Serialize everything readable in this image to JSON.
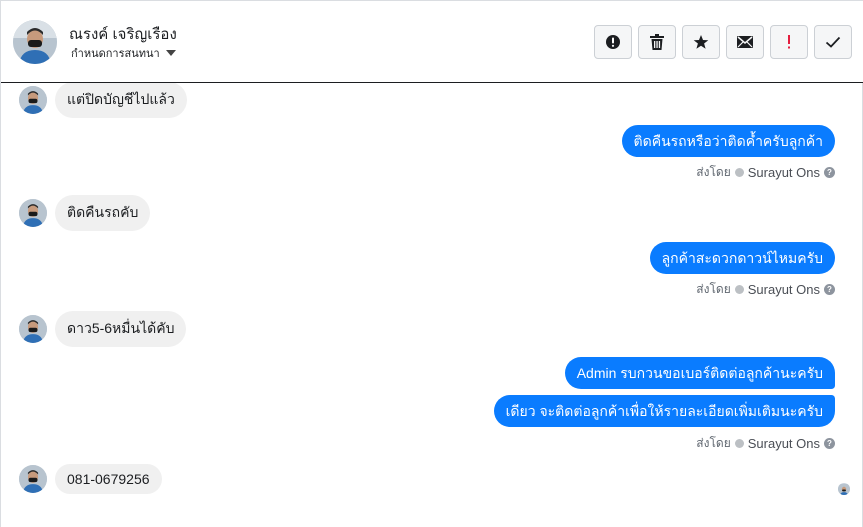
{
  "header": {
    "contact_name": "ณรงค์ เจริญเรือง",
    "subtitle": "กำหนดการสนทนา",
    "actions": [
      {
        "name": "report-spam-button",
        "icon": "exclamation-circle-icon"
      },
      {
        "name": "delete-button",
        "icon": "trash-icon"
      },
      {
        "name": "star-button",
        "icon": "star-icon"
      },
      {
        "name": "mark-unread-button",
        "icon": "envelope-icon"
      },
      {
        "name": "follow-up-button",
        "icon": "exclamation-icon",
        "color": "#e41e3f"
      },
      {
        "name": "mark-done-button",
        "icon": "check-icon"
      }
    ]
  },
  "messages": [
    {
      "direction": "in",
      "text": "แต่ปิดบัญชีไปแล้ว"
    },
    {
      "direction": "out",
      "text": "ติดคืนรถหรือว่าติดค้ำครับลูกค้า"
    },
    {
      "direction": "in",
      "text": "ติดคืนรถคับ"
    },
    {
      "direction": "out",
      "text": "ลูกค้าสะดวกดาวน์ไหมครับ"
    },
    {
      "direction": "in",
      "text": "ดาว5-6หมื่นได้คับ"
    },
    {
      "direction": "out",
      "text": "Admin รบกวนขอเบอร์ติดต่อลูกค้านะครับ"
    },
    {
      "direction": "out",
      "text": "เดียว จะติดต่อลูกค้าเพื่อให้รายละเอียดเพิ่มเติมนะครับ"
    },
    {
      "direction": "in",
      "text": "081-0679256"
    }
  ],
  "sent_by": {
    "prefix": "ส่งโดย",
    "agent": "Surayut Ons"
  },
  "colors": {
    "outgoing_bubble": "#0a7cff",
    "incoming_bubble": "#f0f0f0",
    "follow_up_accent": "#e41e3f"
  }
}
